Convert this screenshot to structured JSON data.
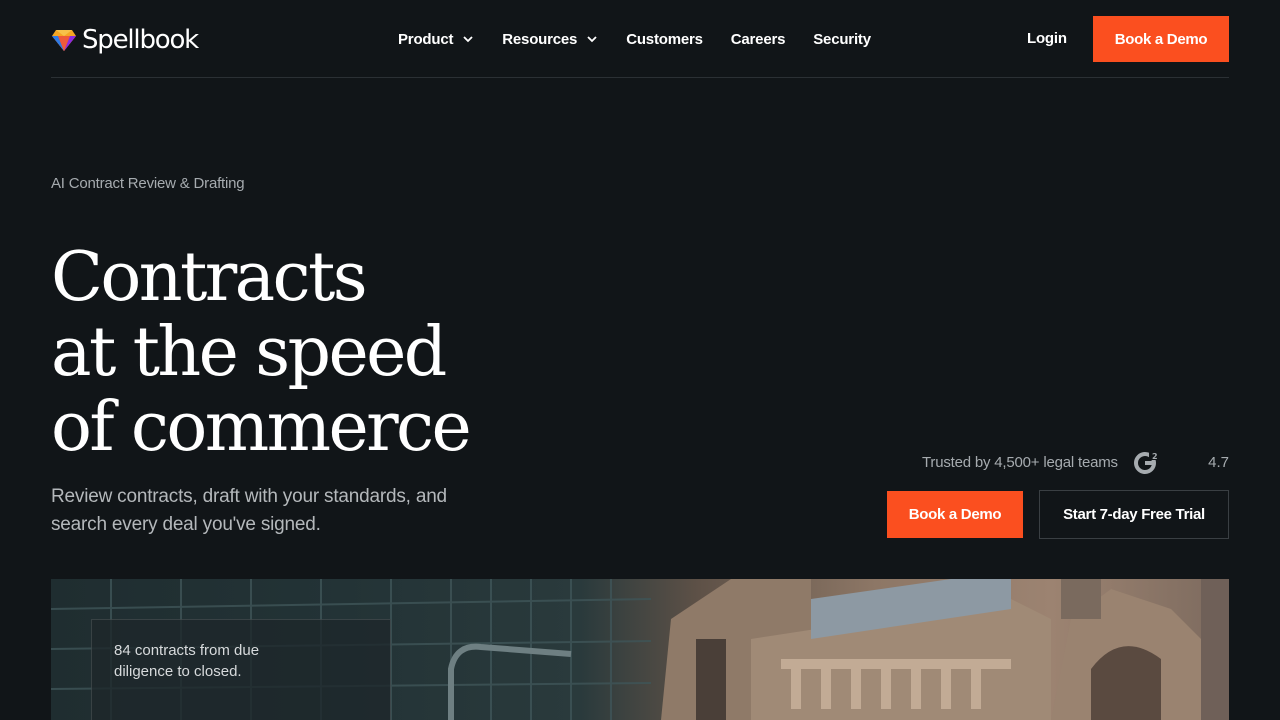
{
  "brand": {
    "name": "Spellbook",
    "logo_icon": "gem-icon"
  },
  "nav": {
    "items": [
      {
        "label": "Product",
        "dropdown": true
      },
      {
        "label": "Resources",
        "dropdown": true
      },
      {
        "label": "Customers",
        "dropdown": false
      },
      {
        "label": "Careers",
        "dropdown": false
      },
      {
        "label": "Security",
        "dropdown": false
      }
    ],
    "login_label": "Login",
    "demo_label": "Book a Demo"
  },
  "hero": {
    "eyebrow": "AI Contract Review & Drafting",
    "headline_lines": [
      "Contracts",
      "at the speed",
      "of commerce"
    ],
    "subtext": "Review contracts, draft with your standards, and search every deal you've signed.",
    "trust_text": "Trusted by 4,500+ legal teams",
    "trust_icon": "g2-icon",
    "rating": "4.7",
    "primary_cta": "Book a Demo",
    "secondary_cta": "Start 7-day Free Trial"
  },
  "showcase": {
    "card_text": "84 contracts from due diligence to closed."
  },
  "colors": {
    "background": "#111518",
    "accent": "#fb4f1f",
    "muted_text": "#a6abaf"
  }
}
